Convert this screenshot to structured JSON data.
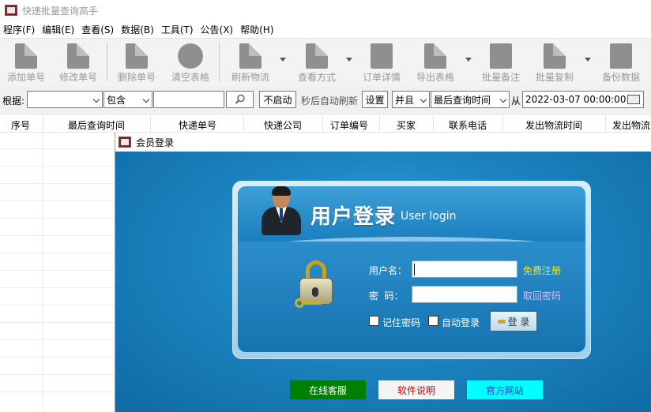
{
  "app": {
    "title": "快递批量查询高手",
    "menu": [
      "程序(F)",
      "编辑(E)",
      "查看(S)",
      "数据(B)",
      "工具(T)",
      "公告(X)",
      "帮助(H)"
    ]
  },
  "toolbar": {
    "buttons": [
      "添加单号",
      "修改单号",
      "删除单号",
      "清空表格",
      "刷新物流",
      "查看方式",
      "订单详情",
      "导出表格",
      "批量备注",
      "批量复制",
      "备份数据"
    ]
  },
  "filter": {
    "basis_label": "根据:",
    "basis_value": "",
    "match_value": "包含",
    "keyword": "",
    "auto_refresh_button": "不启动",
    "auto_refresh_text": "秒后自动刷新",
    "set_button": "设置",
    "logic_value": "并且",
    "time_field_value": "最后查询时间",
    "from_label": "从",
    "from_date": "2022-03-07 00:00:00"
  },
  "grid": {
    "columns": [
      "序号",
      "最后查询时间",
      "快递单号",
      "快递公司",
      "订单编号",
      "买家",
      "联系电话",
      "发出物流时间",
      "发出物流"
    ]
  },
  "dialog": {
    "title": "会员登录",
    "heading": "用户登录",
    "subheading": "User login",
    "username_label": "用户名：",
    "username_value": "",
    "password_label": "密  码：",
    "password_value": "",
    "register_link": "免费注册",
    "recover_link": "取回密码",
    "remember_label": "记住密码",
    "autologin_label": "自动登录",
    "login_button": "登 录",
    "bottom_buttons": [
      "在线客服",
      "软件说明",
      "官方网站"
    ],
    "colors": {
      "register_link": "#ffe600",
      "recover_link": "#dcb9ff",
      "online_service_bg": "#008000",
      "manual_bg": "#f4f4f4",
      "website_bg": "#00ffff"
    }
  }
}
